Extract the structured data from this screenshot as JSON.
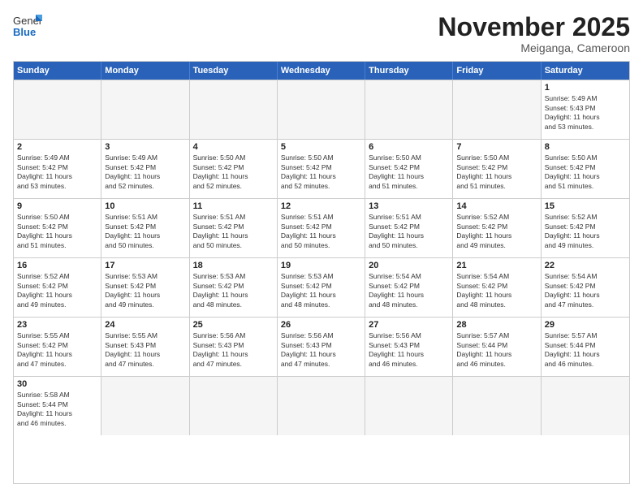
{
  "header": {
    "logo_general": "General",
    "logo_blue": "Blue",
    "month_title": "November 2025",
    "location": "Meiganga, Cameroon"
  },
  "days_of_week": [
    "Sunday",
    "Monday",
    "Tuesday",
    "Wednesday",
    "Thursday",
    "Friday",
    "Saturday"
  ],
  "weeks": [
    [
      {
        "day": "",
        "text": ""
      },
      {
        "day": "",
        "text": ""
      },
      {
        "day": "",
        "text": ""
      },
      {
        "day": "",
        "text": ""
      },
      {
        "day": "",
        "text": ""
      },
      {
        "day": "",
        "text": ""
      },
      {
        "day": "1",
        "text": "Sunrise: 5:49 AM\nSunset: 5:43 PM\nDaylight: 11 hours\nand 53 minutes."
      }
    ],
    [
      {
        "day": "2",
        "text": "Sunrise: 5:49 AM\nSunset: 5:42 PM\nDaylight: 11 hours\nand 53 minutes."
      },
      {
        "day": "3",
        "text": "Sunrise: 5:49 AM\nSunset: 5:42 PM\nDaylight: 11 hours\nand 52 minutes."
      },
      {
        "day": "4",
        "text": "Sunrise: 5:50 AM\nSunset: 5:42 PM\nDaylight: 11 hours\nand 52 minutes."
      },
      {
        "day": "5",
        "text": "Sunrise: 5:50 AM\nSunset: 5:42 PM\nDaylight: 11 hours\nand 52 minutes."
      },
      {
        "day": "6",
        "text": "Sunrise: 5:50 AM\nSunset: 5:42 PM\nDaylight: 11 hours\nand 51 minutes."
      },
      {
        "day": "7",
        "text": "Sunrise: 5:50 AM\nSunset: 5:42 PM\nDaylight: 11 hours\nand 51 minutes."
      },
      {
        "day": "8",
        "text": "Sunrise: 5:50 AM\nSunset: 5:42 PM\nDaylight: 11 hours\nand 51 minutes."
      }
    ],
    [
      {
        "day": "9",
        "text": "Sunrise: 5:50 AM\nSunset: 5:42 PM\nDaylight: 11 hours\nand 51 minutes."
      },
      {
        "day": "10",
        "text": "Sunrise: 5:51 AM\nSunset: 5:42 PM\nDaylight: 11 hours\nand 50 minutes."
      },
      {
        "day": "11",
        "text": "Sunrise: 5:51 AM\nSunset: 5:42 PM\nDaylight: 11 hours\nand 50 minutes."
      },
      {
        "day": "12",
        "text": "Sunrise: 5:51 AM\nSunset: 5:42 PM\nDaylight: 11 hours\nand 50 minutes."
      },
      {
        "day": "13",
        "text": "Sunrise: 5:51 AM\nSunset: 5:42 PM\nDaylight: 11 hours\nand 50 minutes."
      },
      {
        "day": "14",
        "text": "Sunrise: 5:52 AM\nSunset: 5:42 PM\nDaylight: 11 hours\nand 49 minutes."
      },
      {
        "day": "15",
        "text": "Sunrise: 5:52 AM\nSunset: 5:42 PM\nDaylight: 11 hours\nand 49 minutes."
      }
    ],
    [
      {
        "day": "16",
        "text": "Sunrise: 5:52 AM\nSunset: 5:42 PM\nDaylight: 11 hours\nand 49 minutes."
      },
      {
        "day": "17",
        "text": "Sunrise: 5:53 AM\nSunset: 5:42 PM\nDaylight: 11 hours\nand 49 minutes."
      },
      {
        "day": "18",
        "text": "Sunrise: 5:53 AM\nSunset: 5:42 PM\nDaylight: 11 hours\nand 48 minutes."
      },
      {
        "day": "19",
        "text": "Sunrise: 5:53 AM\nSunset: 5:42 PM\nDaylight: 11 hours\nand 48 minutes."
      },
      {
        "day": "20",
        "text": "Sunrise: 5:54 AM\nSunset: 5:42 PM\nDaylight: 11 hours\nand 48 minutes."
      },
      {
        "day": "21",
        "text": "Sunrise: 5:54 AM\nSunset: 5:42 PM\nDaylight: 11 hours\nand 48 minutes."
      },
      {
        "day": "22",
        "text": "Sunrise: 5:54 AM\nSunset: 5:42 PM\nDaylight: 11 hours\nand 47 minutes."
      }
    ],
    [
      {
        "day": "23",
        "text": "Sunrise: 5:55 AM\nSunset: 5:42 PM\nDaylight: 11 hours\nand 47 minutes."
      },
      {
        "day": "24",
        "text": "Sunrise: 5:55 AM\nSunset: 5:43 PM\nDaylight: 11 hours\nand 47 minutes."
      },
      {
        "day": "25",
        "text": "Sunrise: 5:56 AM\nSunset: 5:43 PM\nDaylight: 11 hours\nand 47 minutes."
      },
      {
        "day": "26",
        "text": "Sunrise: 5:56 AM\nSunset: 5:43 PM\nDaylight: 11 hours\nand 47 minutes."
      },
      {
        "day": "27",
        "text": "Sunrise: 5:56 AM\nSunset: 5:43 PM\nDaylight: 11 hours\nand 46 minutes."
      },
      {
        "day": "28",
        "text": "Sunrise: 5:57 AM\nSunset: 5:44 PM\nDaylight: 11 hours\nand 46 minutes."
      },
      {
        "day": "29",
        "text": "Sunrise: 5:57 AM\nSunset: 5:44 PM\nDaylight: 11 hours\nand 46 minutes."
      }
    ],
    [
      {
        "day": "30",
        "text": "Sunrise: 5:58 AM\nSunset: 5:44 PM\nDaylight: 11 hours\nand 46 minutes."
      },
      {
        "day": "",
        "text": ""
      },
      {
        "day": "",
        "text": ""
      },
      {
        "day": "",
        "text": ""
      },
      {
        "day": "",
        "text": ""
      },
      {
        "day": "",
        "text": ""
      },
      {
        "day": "",
        "text": ""
      }
    ]
  ]
}
